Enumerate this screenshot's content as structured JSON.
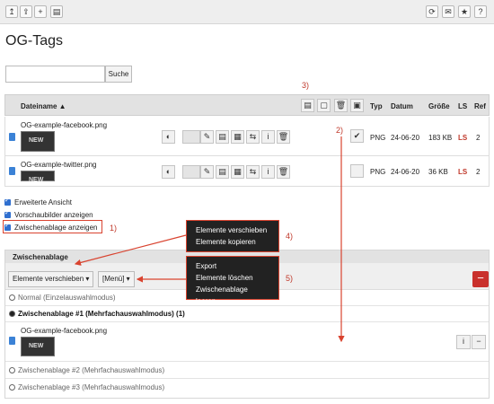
{
  "toolbar": {
    "left_icons": [
      "upload-folder-icon",
      "upload-icon",
      "plus-icon",
      "clipboard-icon"
    ],
    "right_icons": [
      "refresh-icon",
      "mail-icon",
      "star-icon",
      "help-icon"
    ],
    "left_glyphs": [
      "↥",
      "⇪",
      "+",
      "▤"
    ],
    "right_glyphs": [
      "⟳",
      "✉",
      "★",
      "?"
    ]
  },
  "page": {
    "title": "OG-Tags"
  },
  "search": {
    "button": "Suche"
  },
  "table": {
    "headers": {
      "name": "Dateiname ▲",
      "type": "Typ",
      "date": "Datum",
      "size": "Größe",
      "ls": "LS",
      "ref": "Ref"
    },
    "rows": [
      {
        "name": "OG-example-facebook.png",
        "type": "PNG",
        "date": "24-06-20",
        "size": "183 KB",
        "ls": "LS",
        "ref": "2",
        "checked": "✔"
      },
      {
        "name": "OG-example-twitter.png",
        "type": "PNG",
        "date": "24-06-20",
        "size": "36 KB",
        "ls": "LS",
        "ref": "2",
        "checked": ""
      }
    ]
  },
  "options": {
    "extended": "Erweiterte Ansicht",
    "thumbnails": "Vorschaubilder anzeigen",
    "clipboard": "Zwischenablage anzeigen"
  },
  "clipboard": {
    "header": "Zwischenablage",
    "move_button": "Elemente verschieben ▾",
    "menu_button": "[Menü] ▾",
    "modes": {
      "normal": "Normal (Einzelauswahlmodus)",
      "clip1": "Zwischenablage #1 (Mehrfachauswahlmodus) (1)",
      "clip2": "Zwischenablage #2 (Mehrfachauswahlmodus)",
      "clip3": "Zwischenablage #3 (Mehrfachauswahlmodus)"
    },
    "file": "OG-example-facebook.png"
  },
  "menus": {
    "move": [
      "Elemente verschieben",
      "Elemente kopieren"
    ],
    "more": [
      "Export",
      "Elemente löschen",
      "Zwischenablage leeren"
    ]
  },
  "annotations": {
    "a1": "1)",
    "a2": "2)",
    "a3": "3)",
    "a4": "4)",
    "a5": "5)"
  },
  "colors": {
    "accent": "#2f6fcf",
    "annotation": "#d9432f",
    "danger": "#c9302c"
  }
}
